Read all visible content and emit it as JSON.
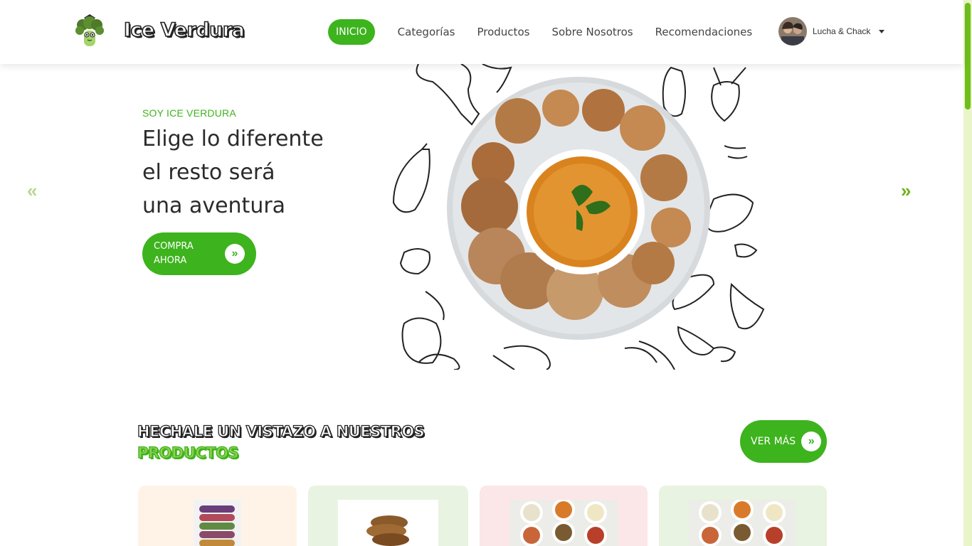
{
  "brand": {
    "name": "Ice Verdura"
  },
  "nav": {
    "items": [
      {
        "label": "INICIO",
        "active": true
      },
      {
        "label": "Categorías"
      },
      {
        "label": "Productos"
      },
      {
        "label": "Sobre Nosotros"
      },
      {
        "label": "Recomendaciones"
      }
    ]
  },
  "user": {
    "name": "Lucha & Chack",
    "avatar_icon": "user-avatar"
  },
  "hero": {
    "eyebrow": "SOY ICE VERDURA",
    "title_lines": [
      "Elige lo diferente",
      "el resto será",
      "una aventura"
    ],
    "cta_label": "COMPRA AHORA",
    "cta_icon": "»",
    "prev_icon": "«",
    "next_icon": "»"
  },
  "products_section": {
    "title_line1": "HECHALE UN VISTAZO A NUESTROS",
    "title_line2": "PRODUCTOS",
    "ver_mas_label": "VER MÁS",
    "ver_mas_icon": "»"
  },
  "colors": {
    "brand_green": "#3db31d",
    "card_peach": "#fff3e8",
    "card_green": "#e8f3e1",
    "card_pink": "#fbe7e7"
  }
}
